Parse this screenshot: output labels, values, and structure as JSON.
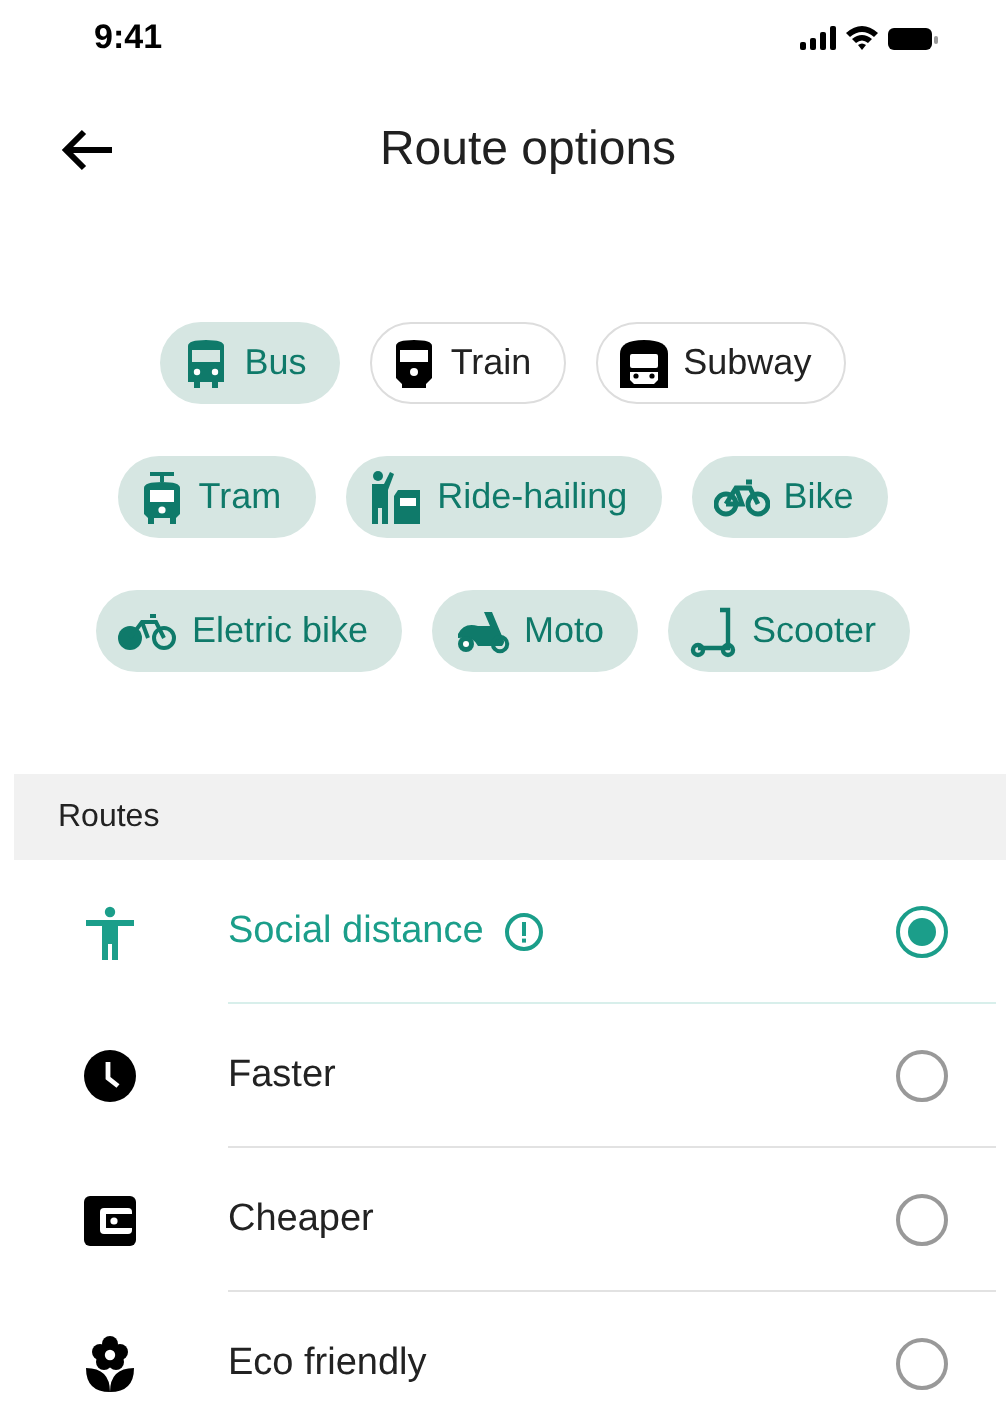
{
  "status_bar": {
    "time": "9:41"
  },
  "header": {
    "title": "Route options"
  },
  "transport_modes": [
    {
      "label": "Bus",
      "selected": true
    },
    {
      "label": "Train",
      "selected": false
    },
    {
      "label": "Subway",
      "selected": false
    },
    {
      "label": "Tram",
      "selected": true
    },
    {
      "label": "Ride-hailing",
      "selected": true
    },
    {
      "label": "Bike",
      "selected": true
    },
    {
      "label": "Eletric bike",
      "selected": true
    },
    {
      "label": "Moto",
      "selected": true
    },
    {
      "label": "Scooter",
      "selected": true
    }
  ],
  "routes": {
    "heading": "Routes",
    "items": [
      {
        "label": "Social distance",
        "selected": true,
        "warning": true
      },
      {
        "label": "Faster",
        "selected": false,
        "warning": false
      },
      {
        "label": "Cheaper",
        "selected": false,
        "warning": false
      },
      {
        "label": "Eco friendly",
        "selected": false,
        "warning": false
      }
    ]
  }
}
